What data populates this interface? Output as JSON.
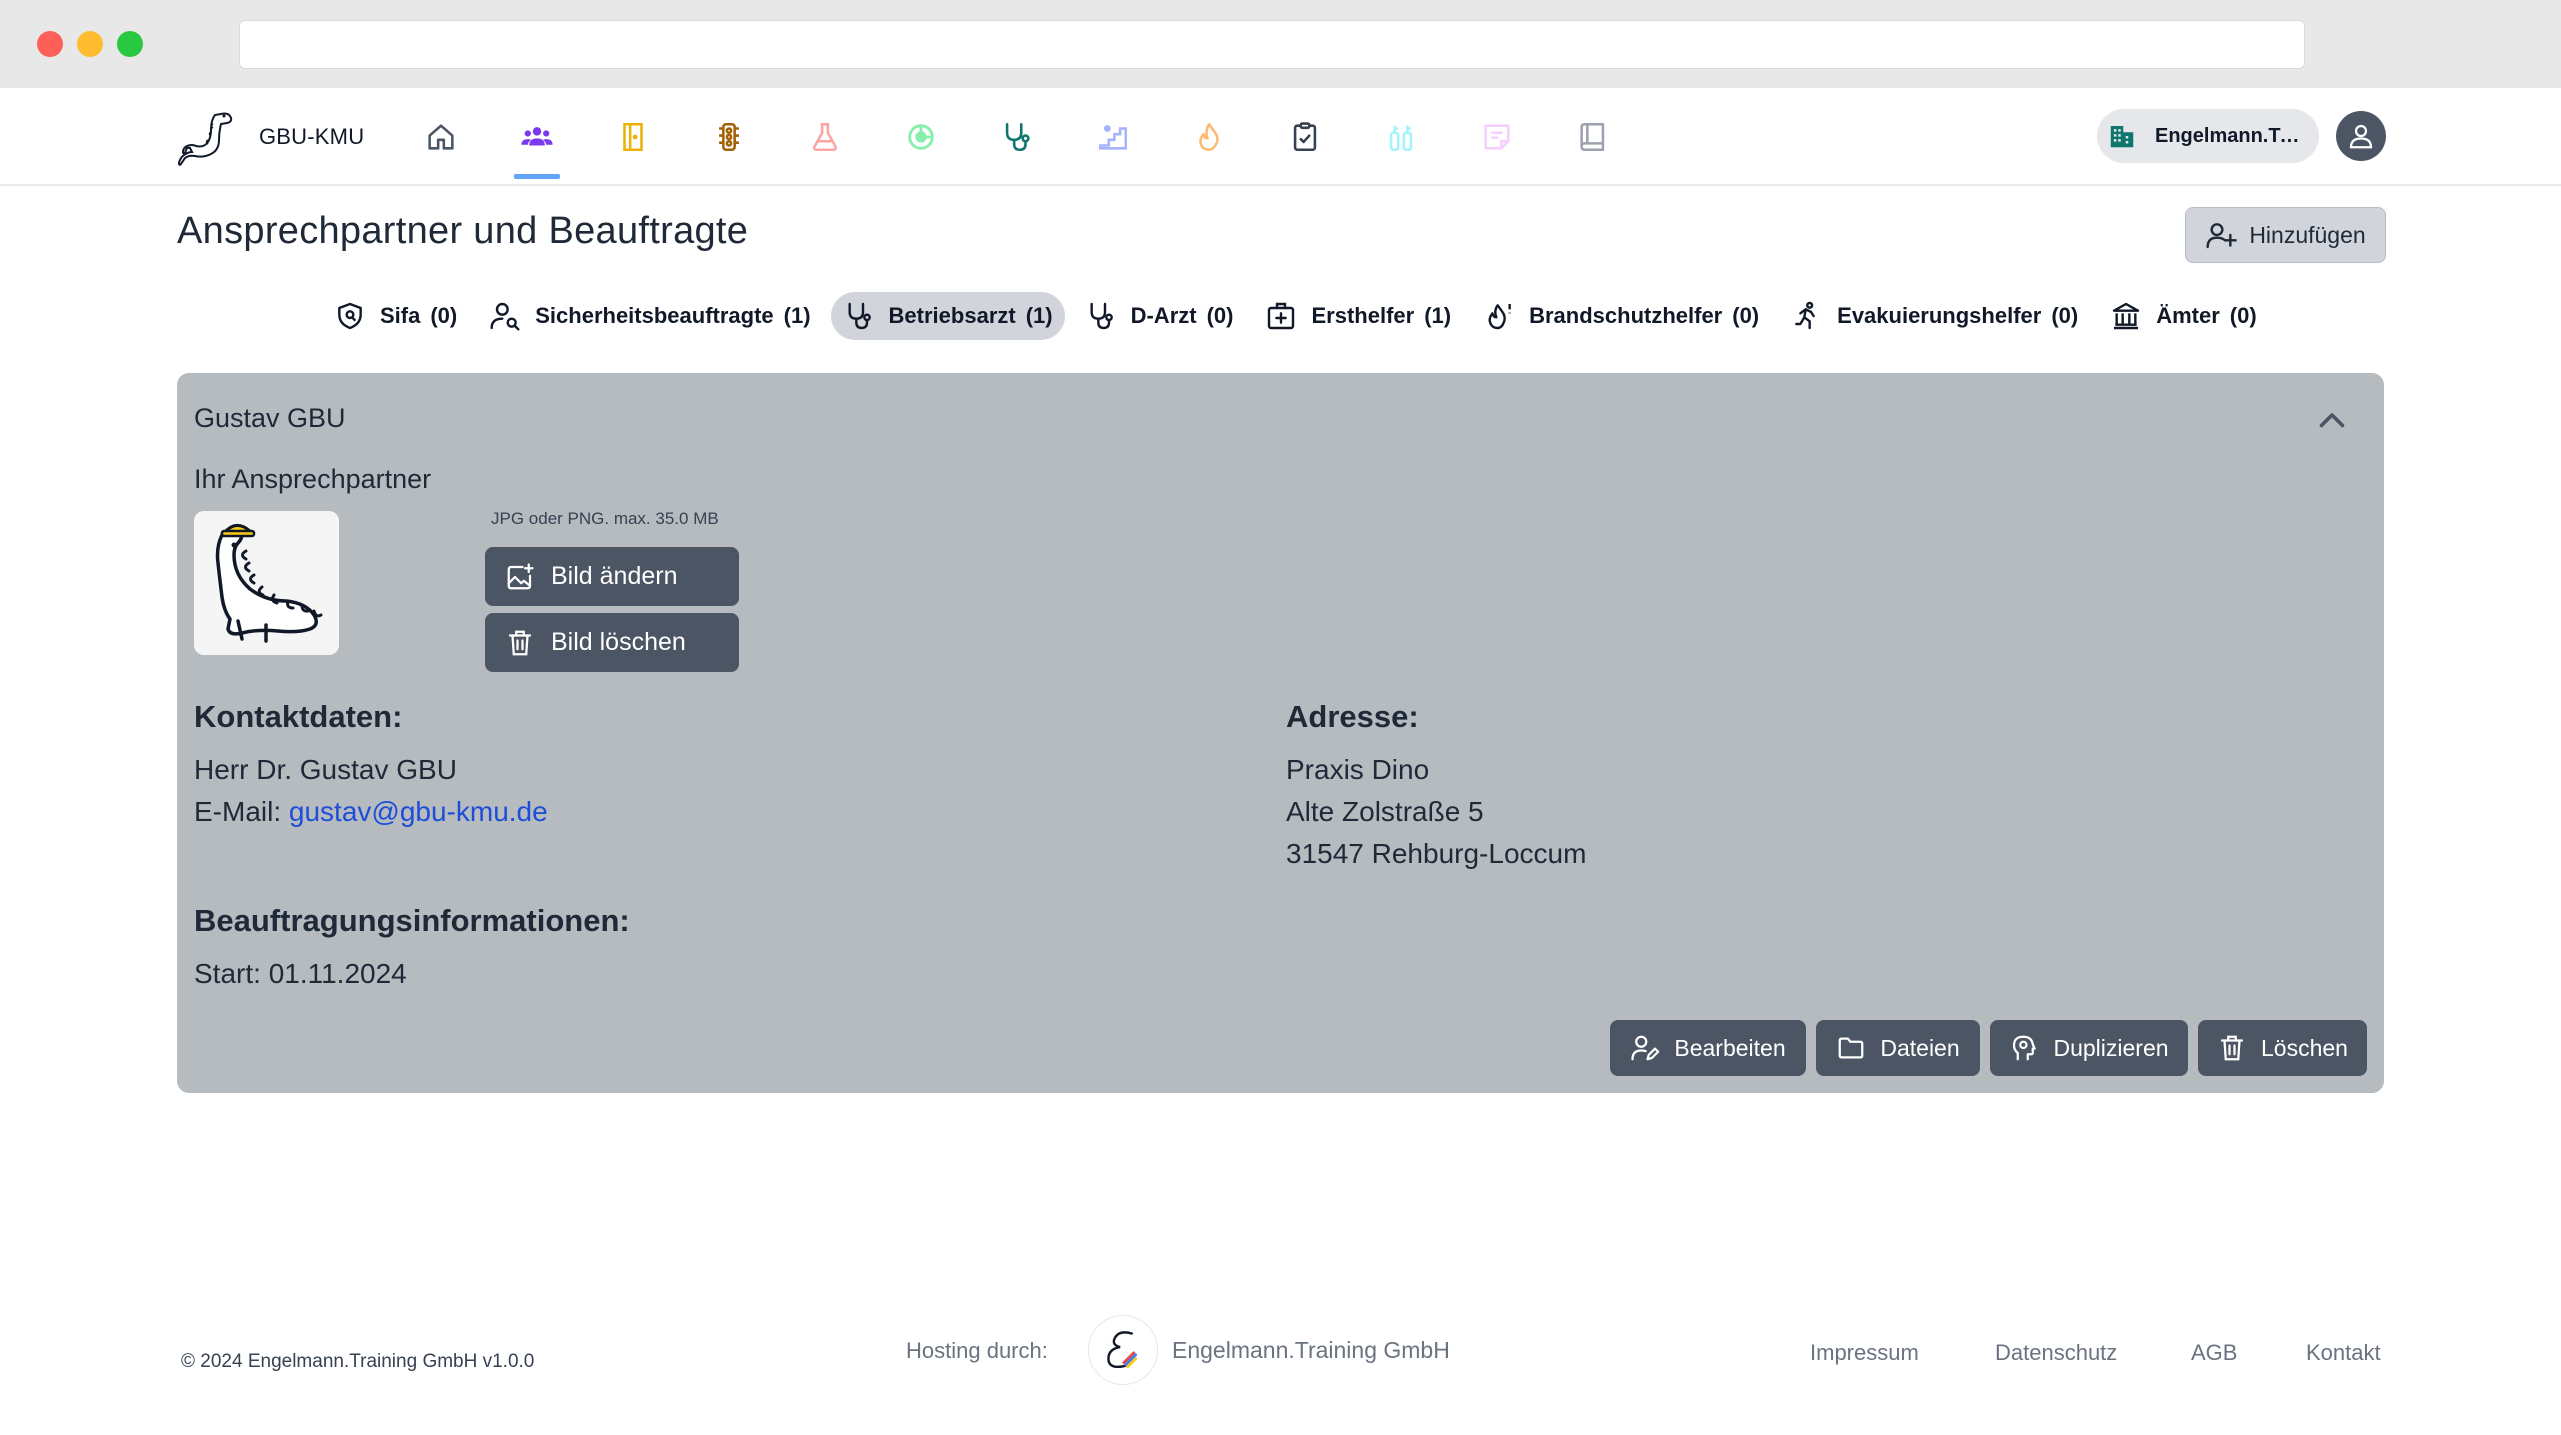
{
  "app": {
    "name": "GBU-KMU",
    "company": "Engelmann.Training GmbH",
    "company_short": "Engelmann.Trai..."
  },
  "nav_icons": [
    {
      "name": "home-icon",
      "color": "#4b5563"
    },
    {
      "name": "people-icon",
      "color": "#7c3aed"
    },
    {
      "name": "door-icon",
      "color": "#eab308"
    },
    {
      "name": "traffic-light-icon",
      "color": "#a16207"
    },
    {
      "name": "flask-icon",
      "color": "#fca5a5"
    },
    {
      "name": "pie-chart-icon",
      "color": "#86efac"
    },
    {
      "name": "stethoscope-icon",
      "color": "#0f766e"
    },
    {
      "name": "stairs-icon",
      "color": "#a5b4fc"
    },
    {
      "name": "fire-icon",
      "color": "#fdba74"
    },
    {
      "name": "clipboard-check-icon",
      "color": "#374151"
    },
    {
      "name": "fire-extinguisher-icon",
      "color": "#a5f3fc"
    },
    {
      "name": "notes-icon",
      "color": "#f5d0fe"
    },
    {
      "name": "book-icon",
      "color": "#9ca3af"
    }
  ],
  "page": {
    "title": "Ansprechpartner und Beauftragte",
    "add_label": "Hinzufügen"
  },
  "tabs": [
    {
      "label": "Sifa",
      "count": "(0)",
      "icon": "shield-icon"
    },
    {
      "label": "Sicherheitsbeauftragte",
      "count": "(1)",
      "icon": "user-search-icon"
    },
    {
      "label": "Betriebsarzt",
      "count": "(1)",
      "icon": "stethoscope-icon",
      "active": true
    },
    {
      "label": "D-Arzt",
      "count": "(0)",
      "icon": "stethoscope-icon"
    },
    {
      "label": "Ersthelfer",
      "count": "(1)",
      "icon": "first-aid-icon"
    },
    {
      "label": "Brandschutzhelfer",
      "count": "(0)",
      "icon": "fire-alert-icon"
    },
    {
      "label": "Evakuierungshelfer",
      "count": "(0)",
      "icon": "running-person-icon"
    },
    {
      "label": "Ämter",
      "count": "(0)",
      "icon": "building-columns-icon"
    }
  ],
  "card": {
    "name": "Gustav GBU",
    "contact_label": "Ihr Ansprechpartner",
    "upload_hint": "JPG oder PNG. max. 35.0 MB",
    "change_image_label": "Bild ändern",
    "delete_image_label": "Bild löschen",
    "contact_heading": "Kontaktdaten:",
    "full_name": "Herr Dr. Gustav GBU",
    "email_prefix": "E-Mail:",
    "email": "gustav@gbu-kmu.de",
    "address_heading": "Adresse:",
    "address_line1": "Praxis Dino",
    "address_line2": "Alte Zolstraße 5",
    "address_line3": "31547 Rehburg-Loccum",
    "assignment_heading": "Beauftragungsinformationen:",
    "start_label": "Start: 01.11.2024",
    "actions": {
      "edit": "Bearbeiten",
      "files": "Dateien",
      "duplicate": "Duplizieren",
      "delete": "Löschen"
    }
  },
  "footer": {
    "copyright": "© 2024 Engelmann.Training GmbH v1.0.0",
    "hosting_label": "Hosting durch:",
    "hosting_company": "Engelmann.Training GmbH",
    "links": {
      "imprint": "Impressum",
      "privacy": "Datenschutz",
      "terms": "AGB",
      "contact": "Kontakt"
    }
  },
  "colors": {
    "card_bg": "#b6bbc0",
    "button_dark": "#4b5563",
    "active_tab_bg": "#d1d5db",
    "link": "#1d4ed8",
    "nav_indicator": "#60a5fa"
  }
}
